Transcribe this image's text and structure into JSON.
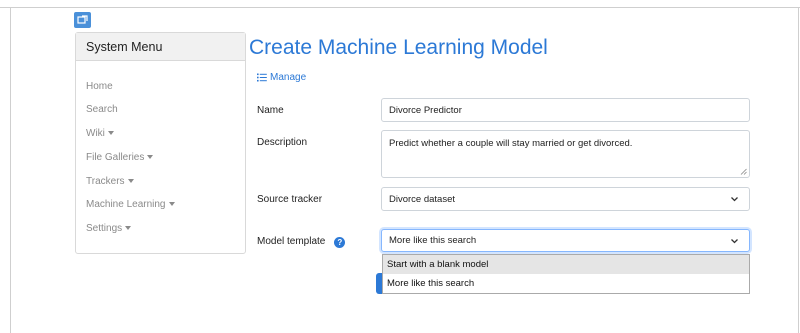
{
  "sidebar": {
    "title": "System Menu",
    "items": [
      {
        "label": "Home",
        "has_caret": false
      },
      {
        "label": "Search",
        "has_caret": false
      },
      {
        "label": "Wiki",
        "has_caret": true
      },
      {
        "label": "File Galleries",
        "has_caret": true
      },
      {
        "label": "Trackers",
        "has_caret": true
      },
      {
        "label": "Machine Learning",
        "has_caret": true
      },
      {
        "label": "Settings",
        "has_caret": true
      }
    ]
  },
  "main": {
    "title": "Create Machine Learning Model",
    "manage_label": "Manage",
    "form": {
      "name_label": "Name",
      "name_value": "Divorce Predictor",
      "description_label": "Description",
      "description_value": "Predict whether a couple will stay married or get divorced.",
      "source_label": "Source tracker",
      "source_value": "Divorce dataset",
      "template_label": "Model template",
      "template_value": "More like this search",
      "template_options": [
        "Start with a blank model",
        "More like this search"
      ]
    }
  },
  "icons": {
    "corner": "app-tile-icon",
    "manage": "list-icon",
    "info": "help-icon",
    "select": "chevron-down-icon"
  },
  "colors": {
    "accent": "#2c79d6",
    "muted_text": "#8a8a8a",
    "highlight": "#e5e5e5"
  }
}
